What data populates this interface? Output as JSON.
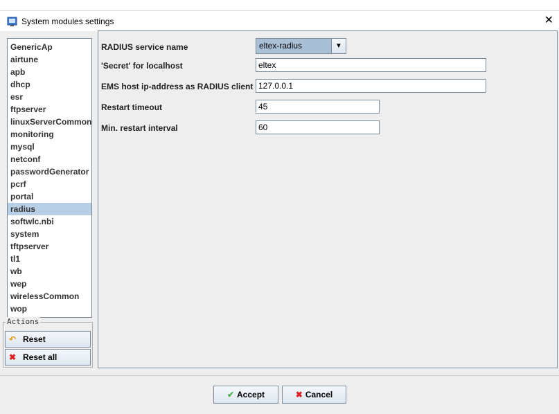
{
  "window": {
    "title": "System modules settings",
    "app_icon": "app-window-icon",
    "close_glyph": "✕"
  },
  "sidebar": {
    "items": [
      {
        "label": "GenericAp"
      },
      {
        "label": "airtune"
      },
      {
        "label": "apb"
      },
      {
        "label": "dhcp"
      },
      {
        "label": "esr"
      },
      {
        "label": "ftpserver"
      },
      {
        "label": "linuxServerCommon"
      },
      {
        "label": "monitoring"
      },
      {
        "label": "mysql"
      },
      {
        "label": "netconf"
      },
      {
        "label": "passwordGenerator"
      },
      {
        "label": "pcrf"
      },
      {
        "label": "portal"
      },
      {
        "label": "radius",
        "selected": true
      },
      {
        "label": "softwlc.nbi"
      },
      {
        "label": "system"
      },
      {
        "label": "tftpserver"
      },
      {
        "label": "tl1"
      },
      {
        "label": "wb"
      },
      {
        "label": "wep"
      },
      {
        "label": "wirelessCommon"
      },
      {
        "label": "wop"
      }
    ]
  },
  "actions": {
    "legend": "Actions",
    "reset_label": "Reset",
    "reset_icon": "undo-icon",
    "reset_all_label": "Reset all",
    "reset_all_icon": "red-x-icon"
  },
  "settings": {
    "service_name_label": "RADIUS service name",
    "service_name_value": "eltex-radius",
    "secret_label": "'Secret' for localhost",
    "secret_value": "eltex",
    "ems_label": "EMS host ip-address as RADIUS client",
    "ems_value": "127.0.0.1",
    "restart_timeout_label": "Restart timeout",
    "restart_timeout_value": "45",
    "min_restart_label": "Min. restart interval",
    "min_restart_value": "60"
  },
  "buttons": {
    "accept_label": "Accept",
    "accept_icon": "check-icon",
    "cancel_label": "Cancel",
    "cancel_icon": "red-x-icon"
  },
  "colors": {
    "selection": "#b8cfe5",
    "combo_bg": "#a8bfd6",
    "accept_check": "#4caf50",
    "cancel_x": "#e02020"
  }
}
